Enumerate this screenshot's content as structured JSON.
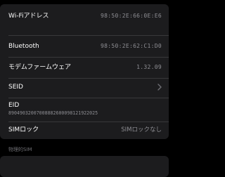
{
  "settings": {
    "rows": [
      {
        "label": "Wi-Fiアドレス",
        "value": "98:50:2E:66:0E:E6"
      },
      {
        "label": "Bluetooth",
        "value": "98:50:2E:62:C1:D0"
      },
      {
        "label": "モデムファームウェア",
        "value": "1.32.09"
      },
      {
        "label": "SEID"
      },
      {
        "label": "EID",
        "value": "89049032007008882600098121922025"
      },
      {
        "label": "SIMロック",
        "value": "SIMロックなし"
      }
    ],
    "section_header": "物理的SIM"
  },
  "colors": {
    "background": "#000000",
    "group": "#1c1c1e",
    "secondary_text": "#8e8e93",
    "separator": "#38383a"
  },
  "icons": {
    "seid_row": "chevron-right-icon"
  }
}
